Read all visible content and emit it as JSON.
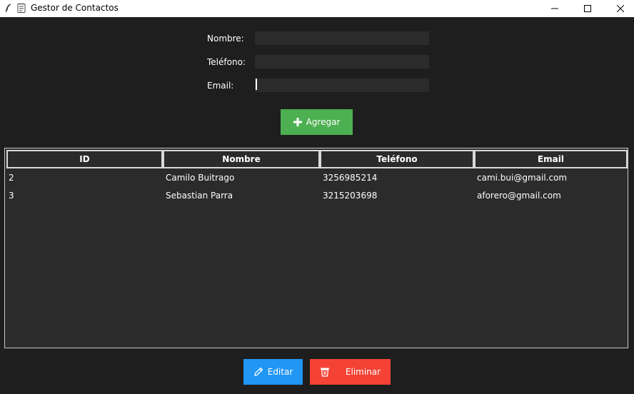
{
  "window": {
    "title": "Gestor de Contactos"
  },
  "form": {
    "nombre_label": "Nombre:",
    "telefono_label": "Teléfono:",
    "email_label": "Email:",
    "nombre_value": "",
    "telefono_value": "",
    "email_value": "",
    "add_label": "Agregar"
  },
  "table": {
    "columns": [
      "ID",
      "Nombre",
      "Teléfono",
      "Email"
    ],
    "rows": [
      [
        "2",
        "Camilo Buitrago",
        "3256985214",
        "cami.bui@gmail.com"
      ],
      [
        "3",
        "Sebastian Parra",
        "3215203698",
        "aforero@gmail.com"
      ]
    ]
  },
  "actions": {
    "edit_label": "Editar",
    "delete_label": "Eliminar"
  },
  "colors": {
    "background": "#1e1e1e",
    "input": "#2b2b2b",
    "add": "#4caf50",
    "edit": "#2196f3",
    "delete": "#f44336"
  },
  "icons": {
    "window": "feather-icon",
    "title": "notepad-icon",
    "add": "plus-icon",
    "edit": "pencil-icon",
    "delete": "trash-icon"
  }
}
